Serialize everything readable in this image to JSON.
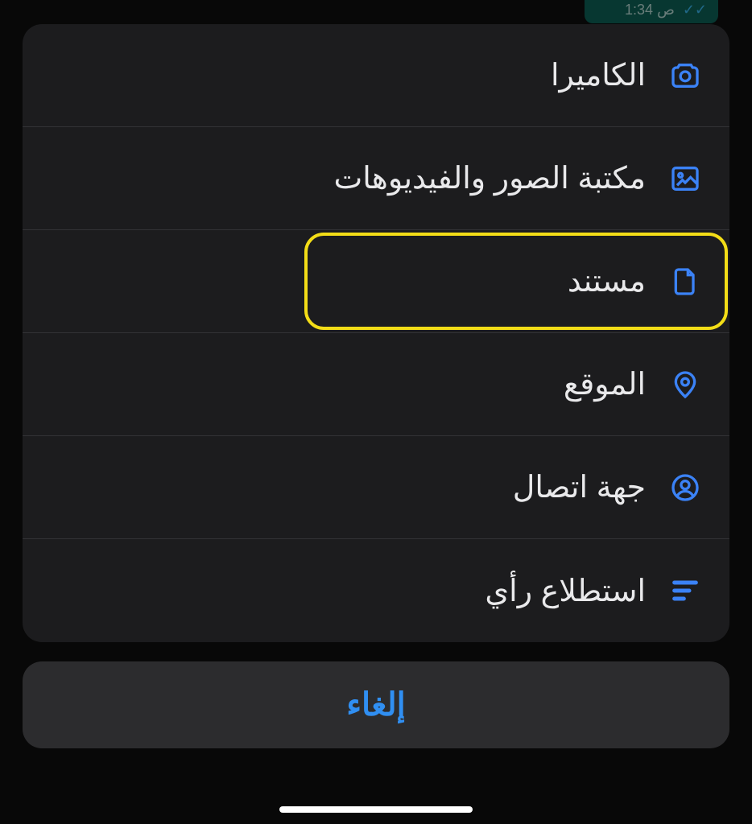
{
  "chat": {
    "time_partial": "ص 1:34"
  },
  "sheet": {
    "items": [
      {
        "label": "الكاميرا",
        "icon": "camera-icon",
        "highlighted": false
      },
      {
        "label": "مكتبة الصور والفيديوهات",
        "icon": "gallery-icon",
        "highlighted": false
      },
      {
        "label": "مستند",
        "icon": "document-icon",
        "highlighted": true
      },
      {
        "label": "الموقع",
        "icon": "location-icon",
        "highlighted": false
      },
      {
        "label": "جهة اتصال",
        "icon": "contact-icon",
        "highlighted": false
      },
      {
        "label": "استطلاع رأي",
        "icon": "poll-icon",
        "highlighted": false
      }
    ]
  },
  "cancel": {
    "label": "إلغاء"
  },
  "colors": {
    "accent": "#3b82f6",
    "highlight": "#f3dd17",
    "sheet_bg": "#1c1c1e",
    "cancel_bg": "#2c2c2e"
  }
}
